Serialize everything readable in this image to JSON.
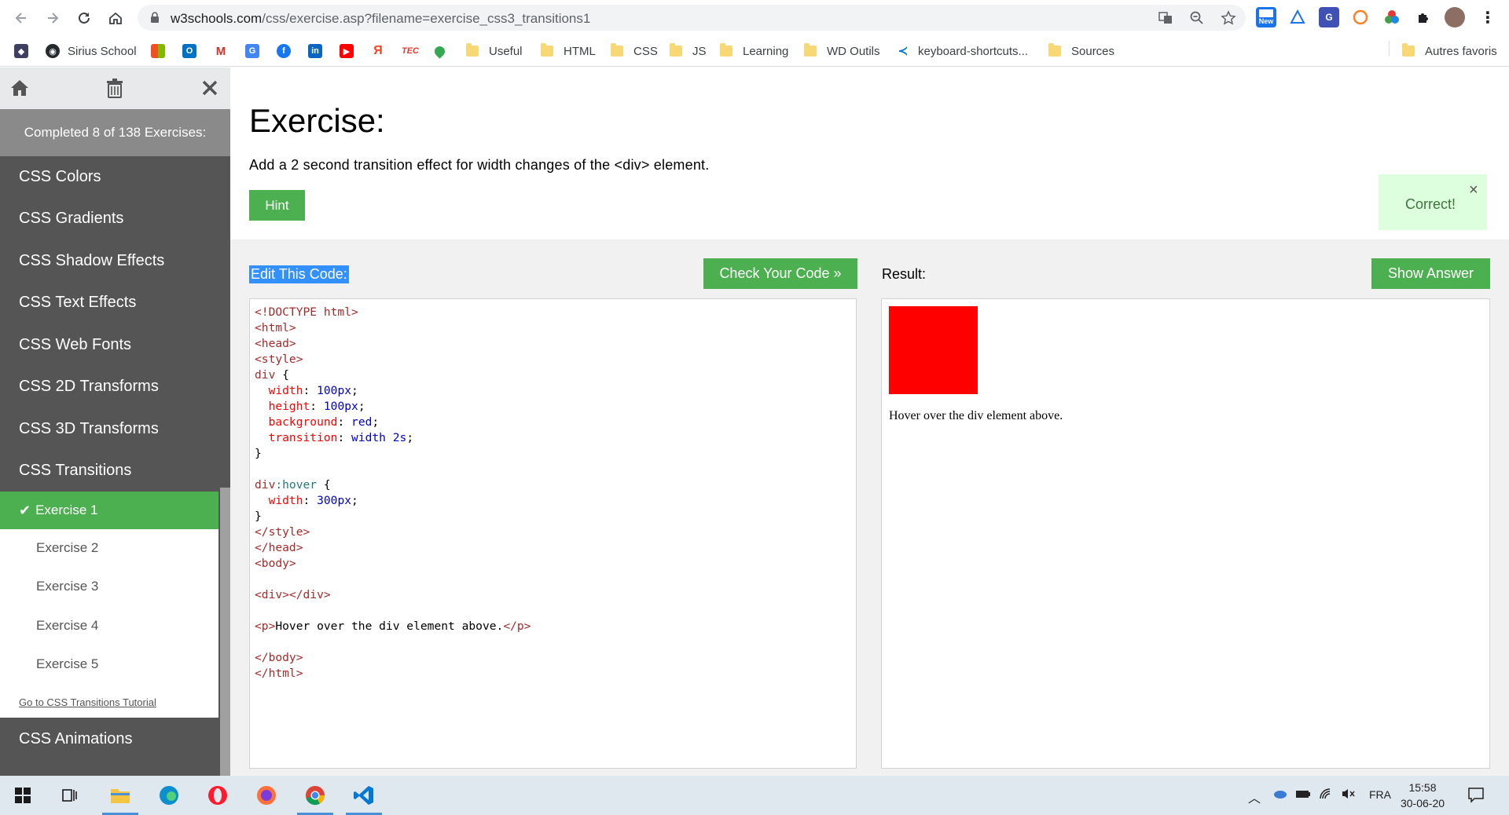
{
  "browser": {
    "url_host": "w3schools.com",
    "url_path": "/css/exercise.asp?filename=exercise_css3_transitions1",
    "new_badge": "New",
    "bookmarks": [
      {
        "label": "Sirius School"
      },
      {
        "label": "Useful"
      },
      {
        "label": "HTML"
      },
      {
        "label": "CSS"
      },
      {
        "label": "JS"
      },
      {
        "label": "Learning"
      },
      {
        "label": "WD Outils"
      },
      {
        "label": "keyboard-shortcuts..."
      },
      {
        "label": "Sources"
      },
      {
        "label": "Autres favoris"
      }
    ]
  },
  "sidebar": {
    "completed": "Completed 8 of 138 Exercises:",
    "topics": [
      "CSS Colors",
      "CSS Gradients",
      "CSS Shadow Effects",
      "CSS Text Effects",
      "CSS Web Fonts",
      "CSS 2D Transforms",
      "CSS 3D Transforms",
      "CSS Transitions"
    ],
    "exercises": [
      "Exercise 1",
      "Exercise 2",
      "Exercise 3",
      "Exercise 4",
      "Exercise 5"
    ],
    "tutorial_link": "Go to CSS Transitions Tutorial",
    "next_topic": "CSS Animations"
  },
  "exercise": {
    "title": "Exercise:",
    "description": "Add a 2 second transition effect for width changes of the <div> element.",
    "hint_label": "Hint",
    "correct_message": "Correct!",
    "close_symbol": "×",
    "edit_label": "Edit This Code:",
    "check_label": "Check Your Code »",
    "result_label": "Result:",
    "answer_label": "Show Answer",
    "result_text": "Hover over the div element above."
  },
  "code_lines": [
    "<!DOCTYPE html>",
    "<html>",
    "<head>",
    "<style>",
    "div {",
    "  width: 100px;",
    "  height: 100px;",
    "  background: red;",
    "  transition: width 2s;",
    "}",
    "",
    "div:hover {",
    "  width: 300px;",
    "}",
    "</style>",
    "</head>",
    "<body>",
    "",
    "<div></div>",
    "",
    "<p>Hover over the div element above.</p>",
    "",
    "</body>",
    "</html>"
  ],
  "taskbar": {
    "language": "FRA",
    "time": "15:58",
    "date": "30-06-20"
  },
  "colors": {
    "accent_green": "#4caf50",
    "sidebar_bg": "#555555",
    "correct_bg": "#ddffdd",
    "result_box": "#ff0000"
  }
}
